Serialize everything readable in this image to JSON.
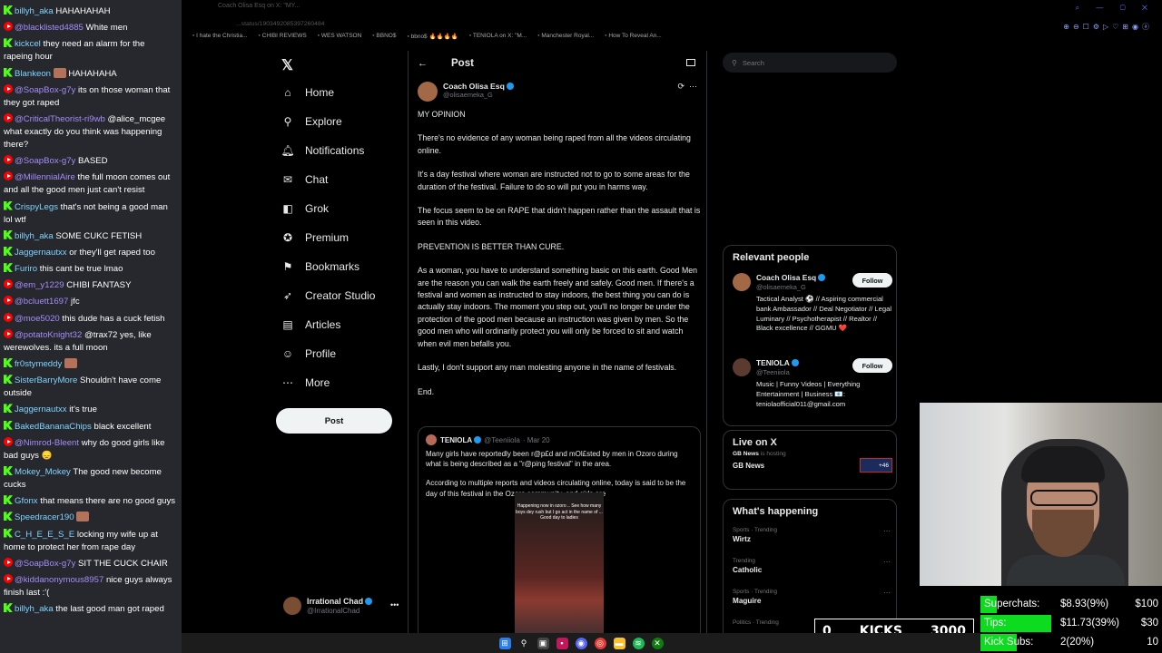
{
  "chat": {
    "messages": [
      {
        "badge": "kick",
        "user": "billyh_aka",
        "text": "HAHAHAHAH"
      },
      {
        "badge": "yt",
        "user": "@blacklisted4885",
        "text": "White men"
      },
      {
        "badge": "kick",
        "user": "kickcel",
        "text": "they need an alarm for the rapeing hour"
      },
      {
        "badge": "kick",
        "user": "Blankeon",
        "text": "HAHAHAHA",
        "emote": true
      },
      {
        "badge": "yt",
        "user": "@SoapBox-g7y",
        "text": "its on those woman that they got raped"
      },
      {
        "badge": "yt",
        "user": "@CriticalTheorist-ri9wb",
        "text": "@alice_mcgee what exactly do you think was happening there?"
      },
      {
        "badge": "yt",
        "user": "@SoapBox-g7y",
        "text": "BASED"
      },
      {
        "badge": "yt",
        "user": "@MillennialAire",
        "text": "the full moon comes out and all the good men just can't resist"
      },
      {
        "badge": "kick",
        "user": "CrispyLegs",
        "text": "that's not being a good man lol wtf"
      },
      {
        "badge": "kick",
        "user": "billyh_aka",
        "text": "SOME CUKC FETISH"
      },
      {
        "badge": "kick",
        "user": "Jaggernautxx",
        "text": "or they'll get raped too"
      },
      {
        "badge": "kick",
        "user": "Furiro",
        "text": "this cant be true lmao"
      },
      {
        "badge": "yt",
        "user": "@em_y1229",
        "text": "CHIBI FANTASY"
      },
      {
        "badge": "yt",
        "user": "@bcluett1697",
        "text": "jfc"
      },
      {
        "badge": "yt",
        "user": "@moe5020",
        "text": "this dude has a cuck fetish"
      },
      {
        "badge": "yt",
        "user": "@potatoKnight32",
        "text": "@trax72 yes, like werewolves. its a full moon"
      },
      {
        "badge": "kick",
        "user": "fr0stymeddy",
        "text": "",
        "emote": true
      },
      {
        "badge": "kick",
        "user": "SisterBarryMore",
        "text": "Shouldn't have come outside"
      },
      {
        "badge": "kick",
        "user": "Jaggernautxx",
        "text": "it's true"
      },
      {
        "badge": "kick",
        "user": "BakedBananaChips",
        "text": "black excellent"
      },
      {
        "badge": "yt",
        "user": "@Nimrod-Bleent",
        "text": "why do good girls like bad guys 😞"
      },
      {
        "badge": "kick",
        "user": "Mokey_Mokey",
        "text": "The good new become cucks"
      },
      {
        "badge": "kick",
        "user": "Gfonx",
        "text": "that means there are no good guys"
      },
      {
        "badge": "kick",
        "user": "Speedracer190",
        "text": "",
        "emote": true
      },
      {
        "badge": "kick",
        "user": "C_H_E_E_S_E",
        "text": "locking my wife up at home to protect her from rape day"
      },
      {
        "badge": "yt",
        "user": "@SoapBox-g7y",
        "text": "SIT THE CUCK CHAIR"
      },
      {
        "badge": "yt",
        "user": "@kiddanonymous8957",
        "text": "nice guys always finish last :'("
      },
      {
        "badge": "kick",
        "user": "billyh_aka",
        "text": "the last good man got raped"
      }
    ]
  },
  "browser": {
    "tab_title": "Coach Olisa Esq on X: \"MY...",
    "address": "...status/1903492085397260484",
    "bookmarks": [
      "I hate the Christia...",
      "CHIBI REVIEWS",
      "WES WATSON",
      "BBNO$",
      "bbno$ 🔥🔥🔥🔥",
      "TENIOLA on X: \"M...",
      "Manchester Royal...",
      "How To Reveal An..."
    ]
  },
  "nav": {
    "items": [
      {
        "label": "Home",
        "icon": "home-icon",
        "glyph": "⌂"
      },
      {
        "label": "Explore",
        "icon": "search-icon",
        "glyph": "⚲"
      },
      {
        "label": "Notifications",
        "icon": "bell-icon",
        "glyph": "🔔︎"
      },
      {
        "label": "Chat",
        "icon": "envelope-icon",
        "glyph": "✉"
      },
      {
        "label": "Grok",
        "icon": "grok-icon",
        "glyph": "◧"
      },
      {
        "label": "Premium",
        "icon": "premium-icon",
        "glyph": "✪"
      },
      {
        "label": "Bookmarks",
        "icon": "bookmark-icon",
        "glyph": "⚑"
      },
      {
        "label": "Creator Studio",
        "icon": "rocket-icon",
        "glyph": "➶"
      },
      {
        "label": "Articles",
        "icon": "articles-icon",
        "glyph": "▤"
      },
      {
        "label": "Profile",
        "icon": "profile-icon",
        "glyph": "☺"
      },
      {
        "label": "More",
        "icon": "more-icon",
        "glyph": "⋯"
      }
    ],
    "post_label": "Post",
    "account": {
      "name": "Irrational Chad",
      "handle": "@IrrationalChad"
    }
  },
  "main": {
    "header_title": "Post",
    "author": {
      "name": "Coach Olisa Esq",
      "handle": "@olisaemeka_G"
    },
    "paragraphs": [
      "MY OPINION",
      "There's no evidence of any woman being raped from all the videos circulating online.",
      "It's a day festival where woman are instructed not to go to some areas for the duration of the festival. Failure to do so will put you in harms way.",
      "The focus seem to be on RAPE that didn't happen rather than the assault that is seen in this video.",
      "PREVENTION IS BETTER THAN CURE.",
      "As a woman, you have to understand something basic on this earth. Good Men are the reason you can walk the earth freely and safely. Good men.  If there's a festival and women as instructed to stay indoors, the best thing you can do is actually stay indoors. The moment you step out, you'll no longer be under the protection of the good men because an instruction was given by men. So the good men who will ordinarily protect you will only be forced to sit and watch when evil men befalls you.",
      "Lastly, I don't support any man molesting anyone in the name of festivals.",
      "End."
    ],
    "quote": {
      "name": "TENIOLA",
      "handle": "@Teeniiola",
      "date": "· Mar 20",
      "paragraphs": [
        "Many girls have reportedly been r@p£d and mOl£sted by men in Ozoro during what is being described as a \"r@ping festival\" in the area.",
        "According to multiple reports and videos circulating online, today is said to be the day of this festival in the Ozoro community, and girls are"
      ],
      "video_caption": "Happening now in ozoro .. See how many boys dey rush but I go act in the name of ... Good day to ladies"
    }
  },
  "right": {
    "search_placeholder": "Search",
    "relevant_title": "Relevant people",
    "people": [
      {
        "name": "Coach Olisa Esq",
        "handle": "@olisaemeka_G",
        "bio": "Tactical Analyst ⚽ // Aspiring commercial bank Ambassador // Deal Negotiator // Legal Luminary // Psychotherapist // Realtor // Black excellence // GGMU ❤️",
        "follow": "Follow",
        "color": "#a36846"
      },
      {
        "name": "TENIOLA",
        "handle": "@Teeniiola",
        "bio": "Music | Funny Videos | Everything Entertainment | Business 📧: teniolaofficial011@gmail.com",
        "follow": "Follow",
        "color": "#5b3a30"
      }
    ],
    "live_title": "Live on X",
    "live": {
      "host": "GB News",
      "host_suffix": "is hosting",
      "name": "GB News",
      "count": "+46"
    },
    "happening_title": "What's happening",
    "trends": [
      {
        "category": "Sports · Trending",
        "name": "Wirtz"
      },
      {
        "category": "Trending",
        "name": "Catholic"
      },
      {
        "category": "Sports · Trending",
        "name": "Maguire"
      },
      {
        "category": "Politics · Trending",
        "name": ""
      }
    ]
  },
  "kicks": {
    "left": "0",
    "label": "KICKS",
    "goal": "3000"
  },
  "goals": [
    {
      "label": "Superchats:",
      "value": "$8.93(9%)",
      "target": "$100",
      "fraction": 0.09
    },
    {
      "label": "Tips:",
      "value": "$11.73(39%)",
      "target": "$30",
      "fraction": 0.39
    },
    {
      "label": "Kick Subs:",
      "value": "2(20%)",
      "target": "10",
      "fraction": 0.2
    }
  ],
  "colors": {
    "accent": "#1d9bf0",
    "goal_bar": "#0ddb1f",
    "kick_green": "#53fc18",
    "youtube_red": "#ff0000"
  }
}
